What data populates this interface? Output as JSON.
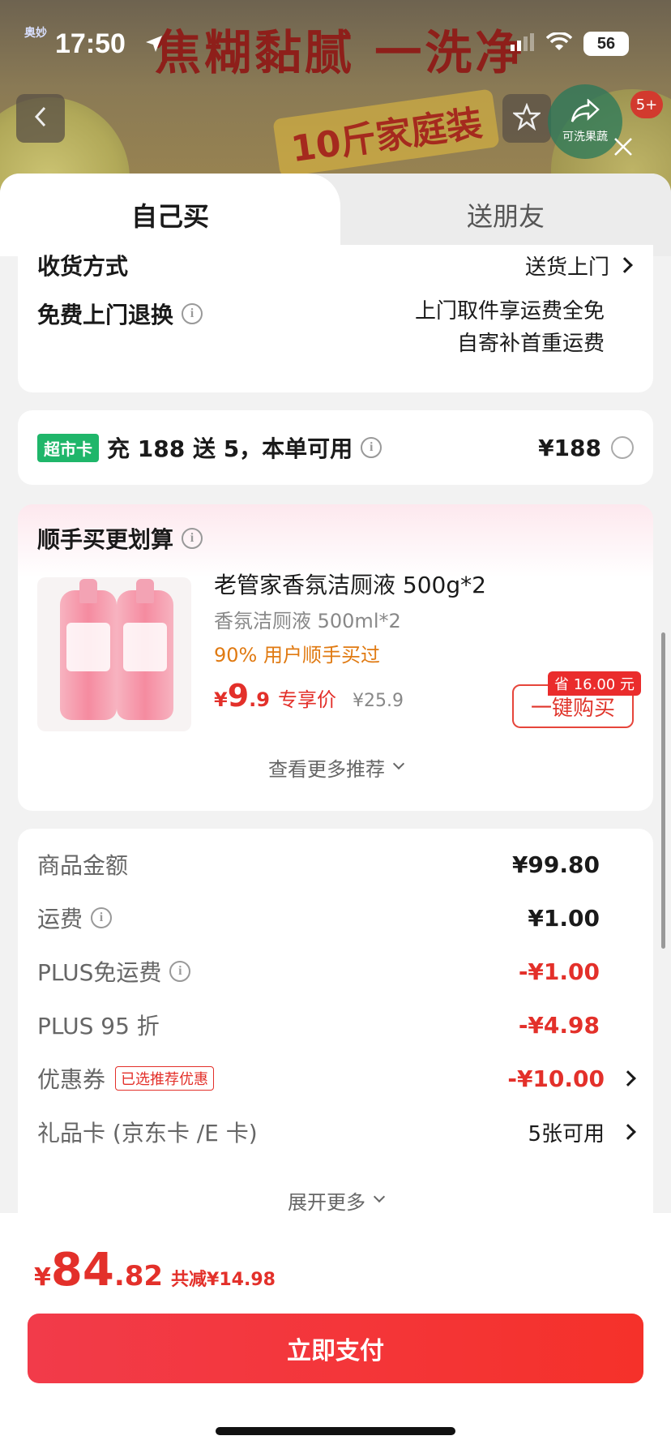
{
  "status_bar": {
    "time": "17:50",
    "battery": "56"
  },
  "background": {
    "banner_line1": "焦糊黏腻 一洗净",
    "banner_line2": "10斤家庭装",
    "brand": "奥妙",
    "share_badge_text": "可洗果蔬",
    "notification_count": "5+"
  },
  "tabs": {
    "self_buy": "自己买",
    "gift": "送朋友"
  },
  "delivery": {
    "method_label": "收货方式",
    "method_value": "送货上门",
    "return_label": "免费上门退换",
    "return_line1": "上门取件享运费全免",
    "return_line2": "自寄补首重运费"
  },
  "supermarket": {
    "tag": "超市卡",
    "text": "充 188 送 5，本单可用",
    "price": "¥188"
  },
  "recommend": {
    "title": "顺手买更划算",
    "product_name": "老管家香氛洁厕液 500g*2",
    "product_spec": "香氛洁厕液 500ml*2",
    "product_note": "90% 用户顺手买过",
    "price_yen": "¥",
    "price_int": "9",
    "price_dec": ".9",
    "price_label": "专享价",
    "original_price": "¥25.9",
    "save_tag": "省 16.00 元",
    "buy_button": "一键购买",
    "more_link": "查看更多推荐"
  },
  "summary": {
    "rows": [
      {
        "label": "商品金额",
        "value": "¥99.80"
      },
      {
        "label": "运费",
        "value": "¥1.00"
      },
      {
        "label": "PLUS免运费",
        "value": "-¥1.00"
      },
      {
        "label": "PLUS 95 折",
        "value": "-¥4.98"
      },
      {
        "label": "优惠券",
        "tag": "已选推荐优惠",
        "value": "-¥10.00"
      },
      {
        "label": "礼品卡 (京东卡 /E 卡)",
        "value": "5张可用"
      }
    ],
    "expand": "展开更多"
  },
  "footer": {
    "total_yen": "¥",
    "total_int": "84",
    "total_dec": ".82",
    "total_less": "共减¥14.98",
    "pay_button": "立即支付"
  },
  "colors": {
    "accent_red": "#e3302a",
    "pay_button": "#f2363a",
    "supermarket_green": "#1fb66a"
  }
}
